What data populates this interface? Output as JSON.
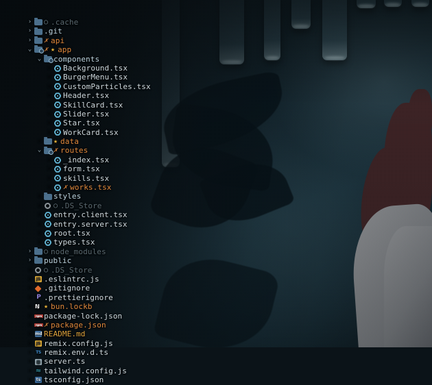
{
  "app": {
    "kind": "code-editor-file-explorer",
    "wallpaper_theme": "dark anime night wallpaper"
  },
  "colors": {
    "default_text": "#cfd9de",
    "directory_text": "#bcd2dd",
    "modified_text": "#e0883c",
    "ignored_text": "#59686f",
    "readme_text": "#e0a33c",
    "react_icon": "#64b8d8",
    "folder_icon": "#4b6f8c",
    "background": "#0d1a20"
  },
  "git_markers": {
    "modified": "✗",
    "untracked": "○",
    "starred": "★"
  },
  "tree": [
    {
      "name": ".cache",
      "depth": 0,
      "type": "folder",
      "icon": "folder-icon",
      "chevron": "›",
      "git": "untracked",
      "color": "dim"
    },
    {
      "name": ".git",
      "depth": 0,
      "type": "folder",
      "icon": "folder-icon",
      "chevron": "›",
      "git": "",
      "color": "dir"
    },
    {
      "name": "api",
      "depth": 0,
      "type": "folder",
      "icon": "folder-icon",
      "chevron": "›",
      "git": "modified",
      "color": "mod"
    },
    {
      "name": "app",
      "depth": 0,
      "type": "folder",
      "icon": "folder-git-icon",
      "chevron": "⌄",
      "git": "modified-starred",
      "color": "mod"
    },
    {
      "name": "components",
      "depth": 1,
      "type": "folder",
      "icon": "folder-git-icon",
      "chevron": "⌄",
      "git": "",
      "color": "dir"
    },
    {
      "name": "Background.tsx",
      "depth": 2,
      "type": "file",
      "icon": "react-icon",
      "chevron": "",
      "git": "",
      "color": "def"
    },
    {
      "name": "BurgerMenu.tsx",
      "depth": 2,
      "type": "file",
      "icon": "react-icon",
      "chevron": "",
      "git": "",
      "color": "def"
    },
    {
      "name": "CustomParticles.tsx",
      "depth": 2,
      "type": "file",
      "icon": "react-icon",
      "chevron": "",
      "git": "",
      "color": "def"
    },
    {
      "name": "Header.tsx",
      "depth": 2,
      "type": "file",
      "icon": "react-icon",
      "chevron": "",
      "git": "",
      "color": "def"
    },
    {
      "name": "SkillCard.tsx",
      "depth": 2,
      "type": "file",
      "icon": "react-icon",
      "chevron": "",
      "git": "",
      "color": "def"
    },
    {
      "name": "Slider.tsx",
      "depth": 2,
      "type": "file",
      "icon": "react-icon",
      "chevron": "",
      "git": "",
      "color": "def"
    },
    {
      "name": "Star.tsx",
      "depth": 2,
      "type": "file",
      "icon": "react-icon",
      "chevron": "",
      "git": "",
      "color": "def"
    },
    {
      "name": "WorkCard.tsx",
      "depth": 2,
      "type": "file",
      "icon": "react-icon",
      "chevron": "",
      "git": "",
      "color": "def"
    },
    {
      "name": "data",
      "depth": 1,
      "type": "folder",
      "icon": "folder-icon",
      "chevron": "",
      "git": "starred",
      "color": "mod"
    },
    {
      "name": "routes",
      "depth": 1,
      "type": "folder",
      "icon": "folder-git-icon",
      "chevron": "⌄",
      "git": "modified",
      "color": "mod"
    },
    {
      "name": "_index.tsx",
      "depth": 2,
      "type": "file",
      "icon": "react-icon",
      "chevron": "",
      "git": "",
      "color": "def"
    },
    {
      "name": "form.tsx",
      "depth": 2,
      "type": "file",
      "icon": "react-icon",
      "chevron": "",
      "git": "",
      "color": "def"
    },
    {
      "name": "skills.tsx",
      "depth": 2,
      "type": "file",
      "icon": "react-icon",
      "chevron": "",
      "git": "",
      "color": "def"
    },
    {
      "name": "works.tsx",
      "depth": 2,
      "type": "file",
      "icon": "react-icon",
      "chevron": "",
      "git": "modified",
      "color": "mod"
    },
    {
      "name": "styles",
      "depth": 1,
      "type": "folder",
      "icon": "folder-icon",
      "chevron": "",
      "git": "",
      "color": "dir"
    },
    {
      "name": ".DS_Store",
      "depth": 1,
      "type": "file",
      "icon": "gear-icon",
      "chevron": "",
      "git": "untracked",
      "color": "dim"
    },
    {
      "name": "entry.client.tsx",
      "depth": 1,
      "type": "file",
      "icon": "react-icon",
      "chevron": "",
      "git": "",
      "color": "def"
    },
    {
      "name": "entry.server.tsx",
      "depth": 1,
      "type": "file",
      "icon": "react-icon",
      "chevron": "",
      "git": "",
      "color": "def"
    },
    {
      "name": "root.tsx",
      "depth": 1,
      "type": "file",
      "icon": "react-icon",
      "chevron": "",
      "git": "",
      "color": "def"
    },
    {
      "name": "types.tsx",
      "depth": 1,
      "type": "file",
      "icon": "react-icon",
      "chevron": "",
      "git": "",
      "color": "def"
    },
    {
      "name": "node_modules",
      "depth": 0,
      "type": "folder",
      "icon": "folder-icon",
      "chevron": "›",
      "git": "untracked",
      "color": "dim"
    },
    {
      "name": "public",
      "depth": 0,
      "type": "folder",
      "icon": "folder-icon",
      "chevron": "›",
      "git": "",
      "color": "dir"
    },
    {
      "name": ".DS_Store",
      "depth": 0,
      "type": "file",
      "icon": "gear-icon",
      "chevron": "",
      "git": "untracked",
      "color": "dim"
    },
    {
      "name": ".eslintrc.js",
      "depth": 0,
      "type": "file",
      "icon": "js-icon",
      "chevron": "",
      "git": "",
      "color": "def"
    },
    {
      "name": ".gitignore",
      "depth": 0,
      "type": "file",
      "icon": "git-icon",
      "chevron": "",
      "git": "",
      "color": "def"
    },
    {
      "name": ".prettierignore",
      "depth": 0,
      "type": "file",
      "icon": "prettier-icon",
      "chevron": "",
      "git": "",
      "color": "def"
    },
    {
      "name": "bun.lockb",
      "depth": 0,
      "type": "file",
      "icon": "bun-icon",
      "chevron": "",
      "git": "starred",
      "color": "mod"
    },
    {
      "name": "package-lock.json",
      "depth": 0,
      "type": "file",
      "icon": "npm-icon",
      "chevron": "",
      "git": "",
      "color": "def"
    },
    {
      "name": "package.json",
      "depth": 0,
      "type": "file",
      "icon": "npm-icon",
      "chevron": "",
      "git": "modified",
      "color": "mod"
    },
    {
      "name": "README.md",
      "depth": 0,
      "type": "file",
      "icon": "markdown-icon",
      "chevron": "",
      "git": "",
      "color": "rdm"
    },
    {
      "name": "remix.config.js",
      "depth": 0,
      "type": "file",
      "icon": "js-icon",
      "chevron": "",
      "git": "",
      "color": "def"
    },
    {
      "name": "remix.env.d.ts",
      "depth": 0,
      "type": "file",
      "icon": "ts-text-icon",
      "chevron": "",
      "git": "",
      "color": "def"
    },
    {
      "name": "server.ts",
      "depth": 0,
      "type": "file",
      "icon": "server-icon",
      "chevron": "",
      "git": "",
      "color": "def"
    },
    {
      "name": "tailwind.config.js",
      "depth": 0,
      "type": "file",
      "icon": "tailwind-icon",
      "chevron": "",
      "git": "",
      "color": "def"
    },
    {
      "name": "tsconfig.json",
      "depth": 0,
      "type": "file",
      "icon": "tsconfig-icon",
      "chevron": "",
      "git": "",
      "color": "def"
    }
  ]
}
